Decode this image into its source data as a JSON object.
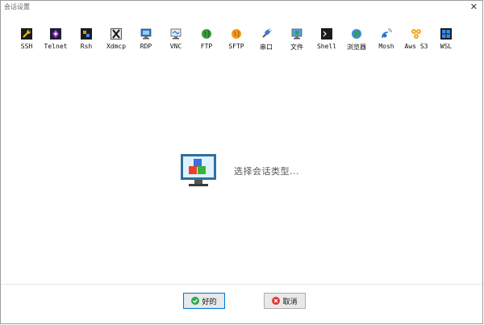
{
  "window": {
    "title": "会话设置",
    "close_glyph": "✕"
  },
  "toolbar": [
    {
      "label": "SSH",
      "icon": "wrench-icon"
    },
    {
      "label": "Telnet",
      "icon": "telnet-icon"
    },
    {
      "label": "Rsh",
      "icon": "rsh-icon"
    },
    {
      "label": "Xdmcp",
      "icon": "x-icon"
    },
    {
      "label": "RDP",
      "icon": "remote-desktop-icon"
    },
    {
      "label": "VNC",
      "icon": "vnc-monitor-icon"
    },
    {
      "label": "FTP",
      "icon": "ftp-globe-icon"
    },
    {
      "label": "SFTP",
      "icon": "sftp-globe-icon"
    },
    {
      "label": "串口",
      "icon": "serial-plug-icon"
    },
    {
      "label": "文件",
      "icon": "file-monitor-icon"
    },
    {
      "label": "Shell",
      "icon": "terminal-icon"
    },
    {
      "label": "浏览器",
      "icon": "browser-globe-icon"
    },
    {
      "label": "Mosh",
      "icon": "satellite-icon"
    },
    {
      "label": "Aws S3",
      "icon": "aws-cubes-icon"
    },
    {
      "label": "WSL",
      "icon": "windows-icon"
    }
  ],
  "main": {
    "prompt": "选择会话类型..."
  },
  "buttons": {
    "ok": "好的",
    "cancel": "取消"
  },
  "colors": {
    "ok_border": "#0078d7",
    "ok_icon": "#2fa84f",
    "cancel_icon": "#e53935"
  }
}
